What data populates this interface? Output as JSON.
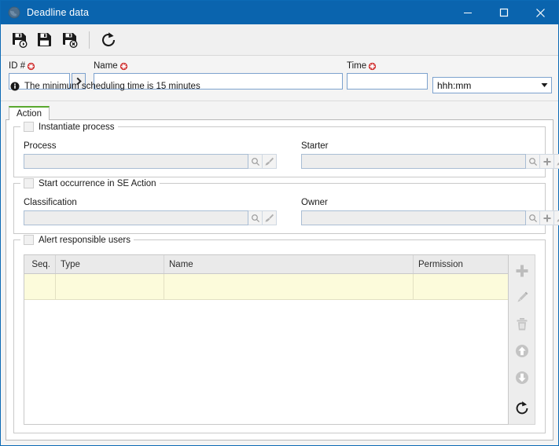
{
  "window": {
    "title": "Deadline data",
    "title_icon": "globe-icon",
    "accent_color": "#0a64ae",
    "controls": [
      {
        "name": "minimize",
        "glyph": "minimize-icon"
      },
      {
        "name": "maximize",
        "glyph": "maximize-icon"
      },
      {
        "name": "close",
        "glyph": "close-icon"
      }
    ]
  },
  "toolbar": {
    "buttons": [
      {
        "name": "save-and-new-button",
        "icon": "save-new-icon"
      },
      {
        "name": "save-button",
        "icon": "save-icon"
      },
      {
        "name": "save-and-close-button",
        "icon": "save-close-icon"
      },
      {
        "name": "refresh-button",
        "icon": "refresh-icon"
      }
    ]
  },
  "header_fields": {
    "id": {
      "label": "ID #",
      "required": true,
      "value": "",
      "placeholder": "",
      "expand_button_icon": "chevron-right-icon"
    },
    "name": {
      "label": "Name",
      "required": true,
      "value": "",
      "placeholder": ""
    },
    "time": {
      "label": "Time",
      "required": true,
      "value": "",
      "placeholder": ""
    },
    "time_format": {
      "selected": "hhh:mm",
      "options": [
        "hhh:mm"
      ],
      "arrow_icon": "chevron-down-icon"
    },
    "info": {
      "icon": "info-icon",
      "text": "The minimum scheduling time is 15 minutes"
    }
  },
  "tabs": {
    "items": [
      {
        "label": "Action",
        "active": true,
        "accent": "#5aa82e"
      }
    ]
  },
  "groups": {
    "instantiate_process": {
      "title": "Instantiate process",
      "checked": false,
      "fields": [
        {
          "label": "Process",
          "value": "",
          "buttons": [
            {
              "name": "process-search-button",
              "icon": "magnifier-icon"
            },
            {
              "name": "process-clear-button",
              "icon": "brush-icon"
            }
          ]
        },
        {
          "label": "Starter",
          "value": "",
          "buttons": [
            {
              "name": "starter-search-button",
              "icon": "magnifier-icon"
            },
            {
              "name": "starter-add-button",
              "icon": "plus-icon"
            },
            {
              "name": "starter-clear-button",
              "icon": "brush-icon"
            }
          ]
        }
      ]
    },
    "start_occurrence": {
      "title": "Start occurrence in SE Action",
      "checked": false,
      "fields": [
        {
          "label": "Classification",
          "value": "",
          "buttons": [
            {
              "name": "classification-search-button",
              "icon": "magnifier-icon"
            },
            {
              "name": "classification-clear-button",
              "icon": "brush-icon"
            }
          ]
        },
        {
          "label": "Owner",
          "value": "",
          "buttons": [
            {
              "name": "owner-search-button",
              "icon": "magnifier-icon"
            },
            {
              "name": "owner-add-button",
              "icon": "plus-icon"
            },
            {
              "name": "owner-clear-button",
              "icon": "brush-icon"
            }
          ]
        }
      ]
    },
    "alert_responsible_users": {
      "title": "Alert responsible users",
      "checked": false,
      "table": {
        "columns": [
          "Seq.",
          "Type",
          "Name",
          "Permission"
        ],
        "rows": [
          {
            "seq": "",
            "type": "",
            "name": "",
            "permission": ""
          }
        ],
        "row_highlight_color": "#fcfbdb"
      },
      "side_buttons": [
        {
          "name": "add-row-button",
          "icon": "plus-icon",
          "enabled": false
        },
        {
          "name": "edit-row-button",
          "icon": "pencil-icon",
          "enabled": false
        },
        {
          "name": "delete-row-button",
          "icon": "trash-icon",
          "enabled": false
        },
        {
          "name": "move-up-button",
          "icon": "arrow-up-circle-icon",
          "enabled": false
        },
        {
          "name": "move-down-button",
          "icon": "arrow-down-circle-icon",
          "enabled": false
        },
        {
          "name": "refresh-grid-button",
          "icon": "refresh-icon",
          "enabled": true
        }
      ]
    }
  }
}
